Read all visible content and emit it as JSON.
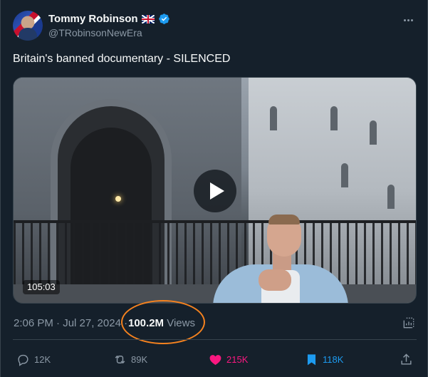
{
  "author": {
    "display_name": "Tommy Robinson",
    "handle": "@TRobinsonNewEra",
    "flag_icon": "uk-flag-icon",
    "verified_icon": "verified-badge-icon"
  },
  "tweet": {
    "text": "Britain's banned documentary - SILENCED",
    "video_duration": "105:03",
    "timestamp": "2:06 PM · Jul 27, 2024 · ",
    "views_count": "100.2M",
    "views_label": " Views"
  },
  "actions": {
    "replies": "12K",
    "reposts": "89K",
    "likes": "215K",
    "bookmarks": "118K"
  },
  "colors": {
    "background": "#15202b",
    "accent_blue": "#1d9bf0",
    "like_pink": "#f91880",
    "annotation_orange": "#f5821f",
    "muted_text": "#8b98a5"
  }
}
